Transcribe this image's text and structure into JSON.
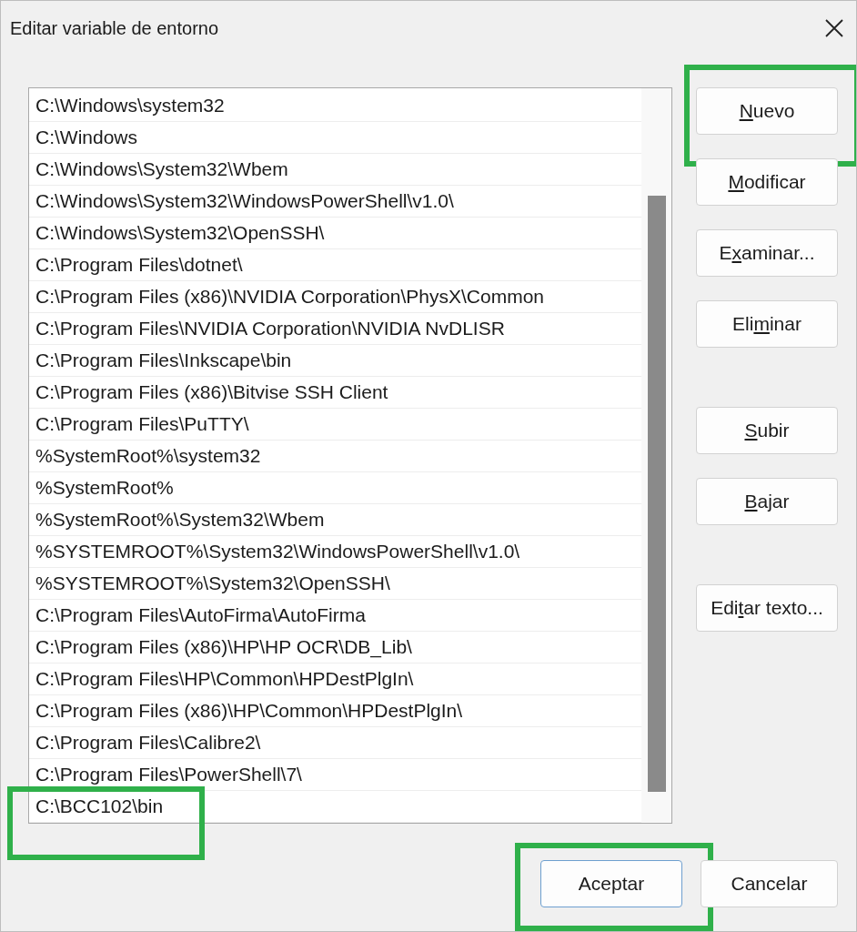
{
  "window": {
    "title": "Editar variable de entorno"
  },
  "list": {
    "rows": [
      {
        "text": "C:\\Windows\\system32",
        "highlighted": false
      },
      {
        "text": "C:\\Windows",
        "highlighted": false
      },
      {
        "text": "C:\\Windows\\System32\\Wbem",
        "highlighted": false
      },
      {
        "text": "C:\\Windows\\System32\\WindowsPowerShell\\v1.0\\",
        "highlighted": false
      },
      {
        "text": "C:\\Windows\\System32\\OpenSSH\\",
        "highlighted": false
      },
      {
        "text": "C:\\Program Files\\dotnet\\",
        "highlighted": false
      },
      {
        "text": "C:\\Program Files (x86)\\NVIDIA Corporation\\PhysX\\Common",
        "highlighted": false
      },
      {
        "text": "C:\\Program Files\\NVIDIA Corporation\\NVIDIA NvDLISR",
        "highlighted": false
      },
      {
        "text": "C:\\Program Files\\Inkscape\\bin",
        "highlighted": false
      },
      {
        "text": "C:\\Program Files (x86)\\Bitvise SSH Client",
        "highlighted": false
      },
      {
        "text": "C:\\Program Files\\PuTTY\\",
        "highlighted": false
      },
      {
        "text": "%SystemRoot%\\system32",
        "highlighted": false
      },
      {
        "text": "%SystemRoot%",
        "highlighted": false
      },
      {
        "text": "%SystemRoot%\\System32\\Wbem",
        "highlighted": false
      },
      {
        "text": "%SYSTEMROOT%\\System32\\WindowsPowerShell\\v1.0\\",
        "highlighted": false
      },
      {
        "text": "%SYSTEMROOT%\\System32\\OpenSSH\\",
        "highlighted": false
      },
      {
        "text": "C:\\Program Files\\AutoFirma\\AutoFirma",
        "highlighted": false
      },
      {
        "text": "C:\\Program Files (x86)\\HP\\HP OCR\\DB_Lib\\",
        "highlighted": false
      },
      {
        "text": "C:\\Program Files\\HP\\Common\\HPDestPlgIn\\",
        "highlighted": false
      },
      {
        "text": "C:\\Program Files (x86)\\HP\\Common\\HPDestPlgIn\\",
        "highlighted": false
      },
      {
        "text": "C:\\Program Files\\Calibre2\\",
        "highlighted": false
      },
      {
        "text": "C:\\Program Files\\PowerShell\\7\\",
        "highlighted": false
      },
      {
        "text": "C:\\BCC102\\bin",
        "highlighted": true
      }
    ]
  },
  "side_button_groups": [
    [
      {
        "access_key": "N",
        "after": "uevo",
        "highlighted": true
      },
      {
        "access_key": "M",
        "after": "odificar",
        "highlighted": false
      },
      {
        "before": "E",
        "access_key": "x",
        "after": "aminar...",
        "highlighted": false
      },
      {
        "before": "Eli",
        "access_key": "m",
        "after": "inar",
        "highlighted": false
      }
    ],
    [
      {
        "access_key": "S",
        "after": "ubir",
        "highlighted": false
      },
      {
        "access_key": "B",
        "after": "ajar",
        "highlighted": false
      }
    ],
    [
      {
        "before": "Edi",
        "access_key": "t",
        "after": "ar texto...",
        "highlighted": false
      }
    ]
  ],
  "footer_buttons": [
    {
      "label": "Aceptar",
      "default": true,
      "highlighted": true
    },
    {
      "label": "Cancelar",
      "default": false,
      "highlighted": false
    }
  ]
}
